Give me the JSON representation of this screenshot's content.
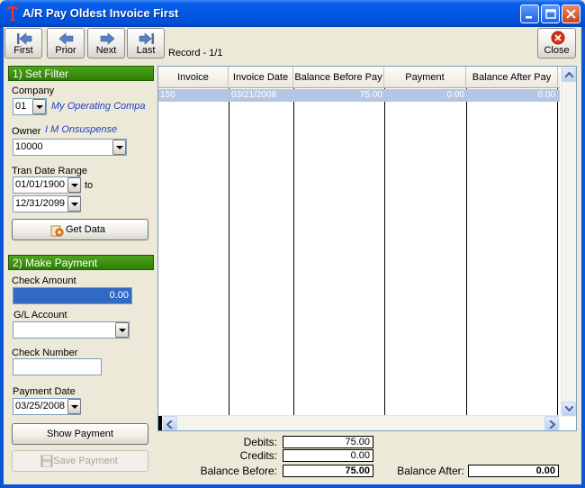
{
  "window": {
    "title": "A/R Pay Oldest Invoice First"
  },
  "toolbar": {
    "first_label": "First",
    "prior_label": "Prior",
    "next_label": "Next",
    "last_label": "Last",
    "record_text": "Record - 1/1",
    "close_label": "Close"
  },
  "filter": {
    "header": "1) Set Filter",
    "company_label": "Company",
    "company_value": "01",
    "company_name": "My Operating Compa",
    "owner_label": "Owner",
    "owner_name": "I M Onsuspense",
    "owner_value": "10000",
    "tran_date_label": "Tran Date Range",
    "date_from": "01/01/1900",
    "to_label": "to",
    "date_to": "12/31/2099",
    "get_data_label": "Get Data"
  },
  "payment": {
    "header": "2) Make Payment",
    "check_amount_label": "Check Amount",
    "check_amount_value": "0.00",
    "gl_account_label": "G/L Account",
    "gl_account_value": "",
    "check_number_label": "Check Number",
    "check_number_value": "",
    "payment_date_label": "Payment Date",
    "payment_date_value": "03/25/2008",
    "show_payment_label": "Show Payment",
    "save_payment_label": "Save Payment"
  },
  "grid": {
    "columns": [
      "Invoice",
      "Invoice Date",
      "Balance Before Pay",
      "Payment",
      "Balance After Pay"
    ],
    "rows": [
      [
        "150",
        "03/21/2008",
        "75.00",
        "0.00",
        "0.00"
      ]
    ]
  },
  "totals": {
    "debits_label": "Debits:",
    "debits_value": "75.00",
    "credits_label": "Credits:",
    "credits_value": "0.00",
    "balance_before_label": "Balance Before:",
    "balance_before_value": "75.00",
    "balance_after_label": "Balance After:",
    "balance_after_value": "0.00"
  },
  "colors": {
    "section_header": "#3a8f0e",
    "selection": "#316ac5",
    "titlebar": "#0058e6"
  }
}
